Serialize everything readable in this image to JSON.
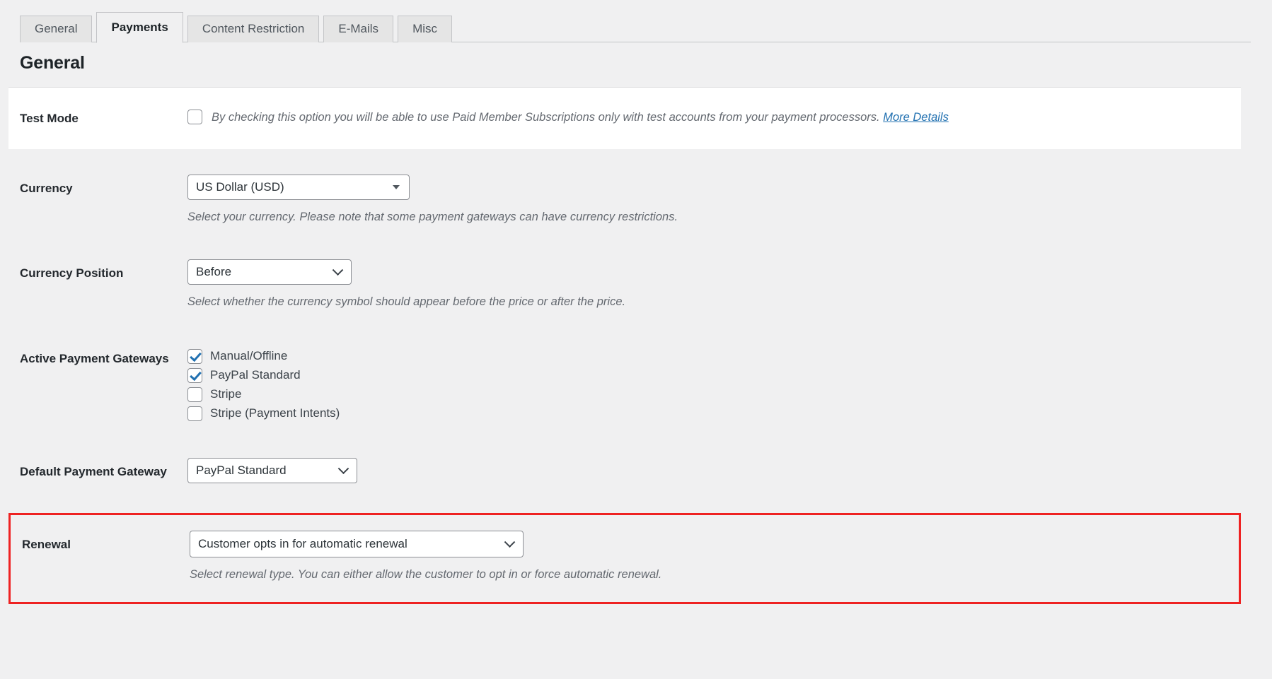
{
  "tabs": [
    {
      "label": "General",
      "active": false
    },
    {
      "label": "Payments",
      "active": true
    },
    {
      "label": "Content Restriction",
      "active": false
    },
    {
      "label": "E-Mails",
      "active": false
    },
    {
      "label": "Misc",
      "active": false
    }
  ],
  "section": {
    "title": "General"
  },
  "rows": {
    "test_mode": {
      "label": "Test Mode",
      "checked": false,
      "description": "By checking this option you will be able to use Paid Member Subscriptions only with test accounts from your payment processors.",
      "link_label": "More Details"
    },
    "currency": {
      "label": "Currency",
      "value": "US Dollar (USD)",
      "description": "Select your currency. Please note that some payment gateways can have currency restrictions."
    },
    "currency_position": {
      "label": "Currency Position",
      "value": "Before",
      "description": "Select whether the currency symbol should appear before the price or after the price."
    },
    "active_payment_gateways": {
      "label": "Active Payment Gateways",
      "options": [
        {
          "label": "Manual/Offline",
          "checked": true
        },
        {
          "label": "PayPal Standard",
          "checked": true
        },
        {
          "label": "Stripe",
          "checked": false
        },
        {
          "label": "Stripe (Payment Intents)",
          "checked": false
        }
      ]
    },
    "default_payment_gateway": {
      "label": "Default Payment Gateway",
      "value": "PayPal Standard"
    },
    "renewal": {
      "label": "Renewal",
      "value": "Customer opts in for automatic renewal",
      "description": "Select renewal type. You can either allow the customer to opt in or force automatic renewal.",
      "highlight_color": "#ee2222"
    }
  },
  "colors": {
    "page_background": "#f0f0f1",
    "card_background": "#ffffff",
    "accent_blue": "#2271b1",
    "label_text": "#23282d",
    "description_text": "#646970",
    "highlight_red": "#ee2222"
  }
}
